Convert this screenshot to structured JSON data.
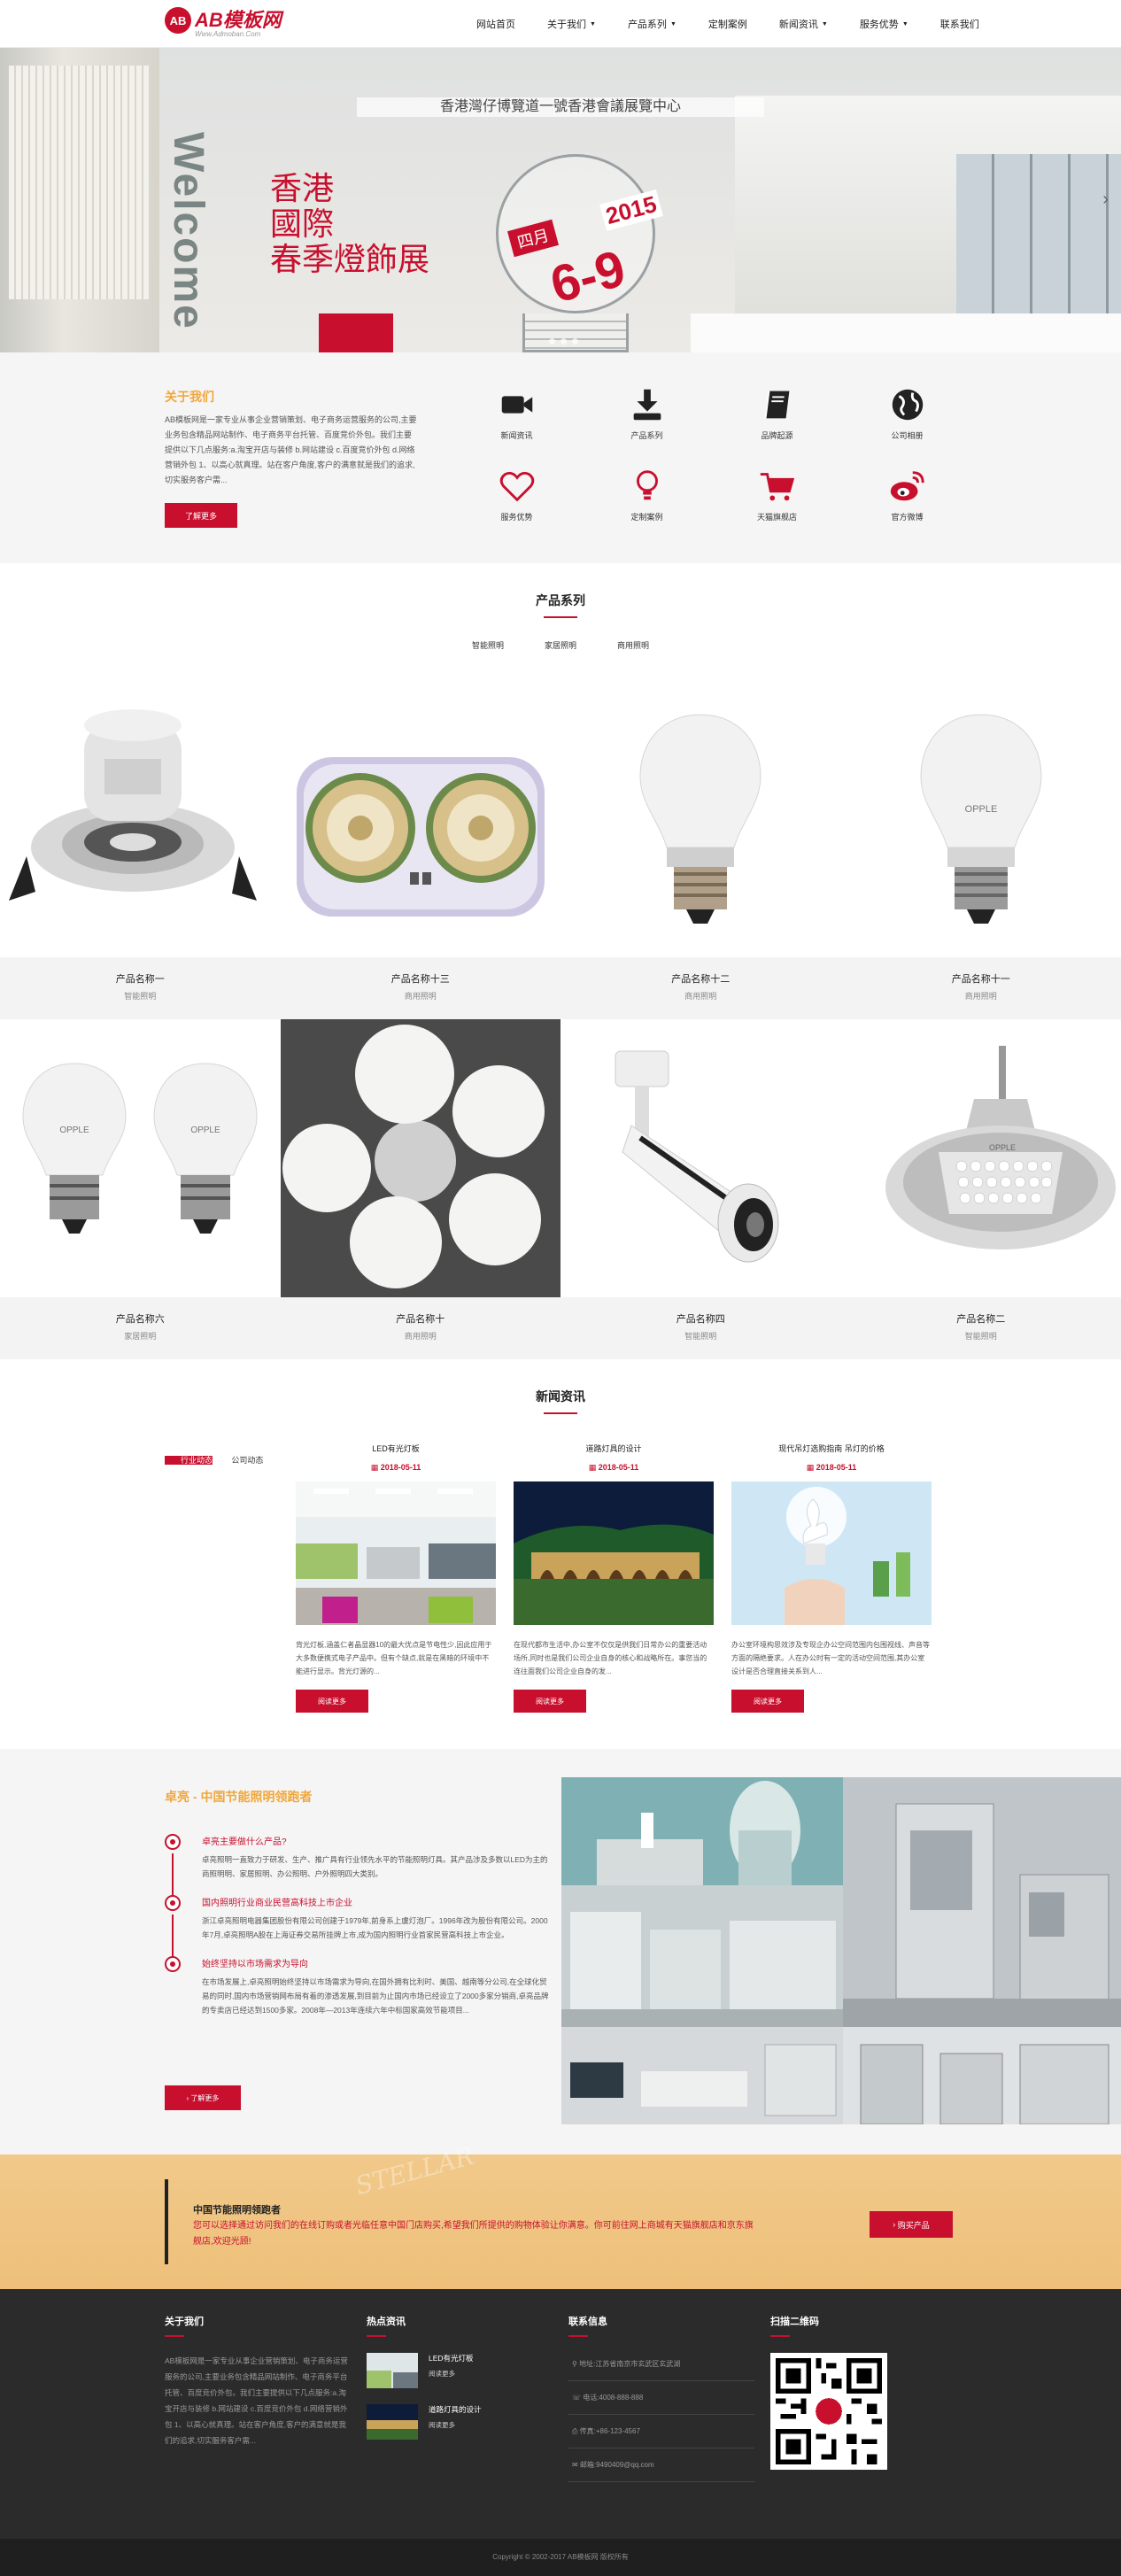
{
  "header": {
    "logo_mark": "AB",
    "logo_text": "AB模板网",
    "logo_sub": "Www.Admoban.Com",
    "nav": [
      {
        "label": "网站首页",
        "caret": false
      },
      {
        "label": "关于我们",
        "caret": true
      },
      {
        "label": "产品系列",
        "caret": true
      },
      {
        "label": "定制案例",
        "caret": false
      },
      {
        "label": "新闻资讯",
        "caret": true
      },
      {
        "label": "服务优势",
        "caret": true
      },
      {
        "label": "联系我们",
        "caret": false
      }
    ]
  },
  "banner": {
    "top_line": "香港灣仔博覽道一號香港會議展覽中心",
    "welcome": "Welcome",
    "title_lines": [
      "香港",
      "國際",
      "春季燈飾展"
    ],
    "month": "四月",
    "year": "2015",
    "date": "6-9"
  },
  "about": {
    "title": "关于我们",
    "text": "AB模板网是一家专业从事企业营销策划、电子商务运营服务的公司,主要业务包含精品网站制作、电子商务平台托管、百度竞价外包。我们主要提供以下几点服务:a.淘宝开店与装修 b.网站建设 c.百度竞价外包 d.网络营销外包 1、以高心就真理。站在客户角度,客户的满意就是我们的追求,切实服务客户需...",
    "button": "了解更多",
    "icons": [
      {
        "label": "新闻资讯",
        "icon": "video-camera-icon"
      },
      {
        "label": "产品系列",
        "icon": "download-icon"
      },
      {
        "label": "品牌起源",
        "icon": "book-icon"
      },
      {
        "label": "公司相册",
        "icon": "globe-icon"
      },
      {
        "label": "服务优势",
        "icon": "heart-icon"
      },
      {
        "label": "定制案例",
        "icon": "lightbulb-icon"
      },
      {
        "label": "天猫旗舰店",
        "icon": "shopping-cart-icon"
      },
      {
        "label": "官方微博",
        "icon": "weibo-icon"
      }
    ]
  },
  "products": {
    "title": "产品系列",
    "tabs": [
      "智能照明",
      "家居照明",
      "商用照明"
    ],
    "items": [
      {
        "name": "产品名称一",
        "cat": "智能照明"
      },
      {
        "name": "产品名称十三",
        "cat": "商用照明"
      },
      {
        "name": "产品名称十二",
        "cat": "商用照明"
      },
      {
        "name": "产品名称十一",
        "cat": "商用照明"
      },
      {
        "name": "产品名称六",
        "cat": "家居照明"
      },
      {
        "name": "产品名称十",
        "cat": "商用照明"
      },
      {
        "name": "产品名称四",
        "cat": "智能照明"
      },
      {
        "name": "产品名称二",
        "cat": "智能照明"
      }
    ],
    "opple": "OPPLE"
  },
  "news": {
    "title": "新闻资讯",
    "tabs": [
      "行业动态",
      "公司动态"
    ],
    "items": [
      {
        "title": "LED有光灯板",
        "date": "2018-05-11",
        "text": "背光灯板,涵盖仁者晶显器10的最大优点是节电性少,因此应用于大多数便携式电子产品中。但有个缺点,就是在黑暗的环境中不能进行显示。背光灯源的...",
        "more": "阅读更多"
      },
      {
        "title": "道路灯具的设计",
        "date": "2018-05-11",
        "text": "在现代都市生活中,办公室不仅仅是供我们日常办公的重要活动场所,同时也是我们公司企业自身的核心和战略所在。事您当的连往面我们公司企业自身的发...",
        "more": "阅读更多"
      },
      {
        "title": "现代吊灯选购指南 吊灯的价格",
        "date": "2018-05-11",
        "text": "办公室环境构思效涉及专现企办公空间范围内包围视线、声音等方面的隔绝要求。人在办公时有一定的活动空间范围,其办公室设计是否合理直接关系到人...",
        "more": "阅读更多"
      }
    ]
  },
  "zhuoliang": {
    "title": "卓亮 - 中国节能照明领跑者",
    "items": [
      {
        "h": "卓亮主要做什么产品?",
        "p": "卓亮照明一直致力于研发、生产、推广具有行业领先水平的节能照明灯具。其产品涉及多数以LED为主的商照明明、家居照明、办公照明、户外照明四大类别。"
      },
      {
        "h": "国内照明行业商业民营高科技上市企业",
        "p": "浙江卓亮照明电器集团股份有限公司创建于1979年,前身系上虞灯泡厂。1996年改为股份有限公司。2000年7月,卓亮照明A股在上海证券交易所挂牌上市,成为国内照明行业首家民营高科技上市企业。"
      },
      {
        "h": "始终坚持以市场需求为导向",
        "p": "在市场发展上,卓亮照明始终坚持以市场需求为导向,在国外拥有比利时、美国、越南等分公司,在全球化贸易的同时,国内市场营销网布局有着的渗透发展,到目前为止国内市场已经设立了2000多家分销商,卓亮品牌的专卖店已经达到1500多家。2008年—2013年连续六年中标国家高效节能项目..."
      }
    ],
    "button": "了解更多"
  },
  "cta": {
    "title": "中国节能照明领跑者",
    "text": "您可以选择通过访问我们的在线订购或者光临任意中国门店购买,希望我们所提供的购物体验让你满意。你可前往网上商城有天猫旗舰店和京东旗舰店,欢迎光顾!",
    "button": "购买产品",
    "deco": "STELLAR"
  },
  "footer": {
    "about_title": "关于我们",
    "about_text": "AB模板网是一家专业从事企业营销策划、电子商务运营服务的公司,主要业务包含精品网站制作、电子商务平台托管、百度竞价外包。我们主要提供以下几点服务:a.淘宝开店与装修 b.网站建设 c.百度竞价外包 d.网络营销外包 1、以高心就真理。站在客户角度,客户的满意就是我们的追求,切实服务客户需...",
    "news_title": "热点资讯",
    "news": [
      {
        "title": "LED有光灯板",
        "more": "阅读更多"
      },
      {
        "title": "道路灯具的设计",
        "more": "阅读更多"
      }
    ],
    "contact_title": "联系信息",
    "contact": [
      "地址:江苏省南京市玄武区玄武湖",
      "电话:4008-888-888",
      "传真:+86-123-4567",
      "邮箱:9490409@qq.com"
    ],
    "qr_title": "扫描二维码",
    "copyright": "Copyright © 2002-2017 AB模板网 版权所有"
  },
  "colors": {
    "brand": "#c8102e",
    "gold": "#f0a73b"
  }
}
